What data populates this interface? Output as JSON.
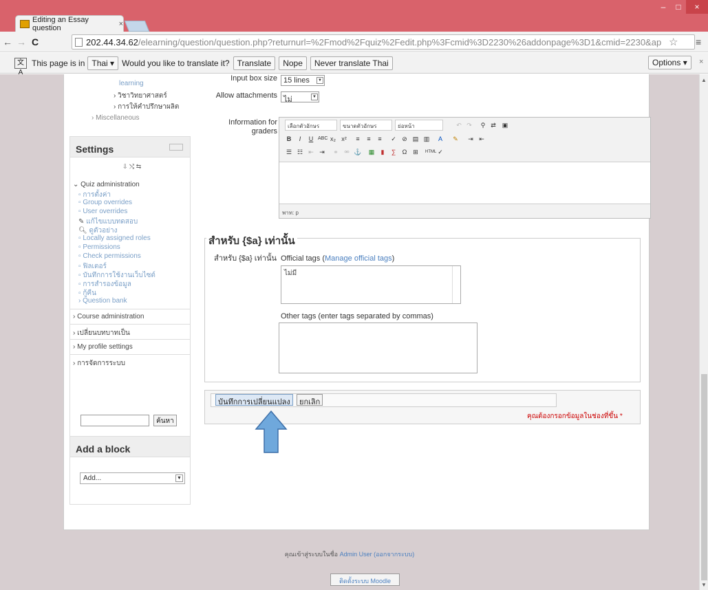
{
  "browser": {
    "tab_title": "Editing an Essay question",
    "tab_close": "×",
    "url_host": "202.44.34.62",
    "url_path": "/elearning/question/question.php?returnurl=%2Fmod%2Fquiz%2Fedit.php%3Fcmid%3D2230%26addonpage%3D1&cmid=2230&ap",
    "translate_bar": {
      "text_prefix": "This page is in",
      "language": "Thai",
      "question": "Would you like to translate it?",
      "translate_label": "Translate",
      "nope_label": "Nope",
      "never_label": "Never translate Thai",
      "options_label": "Options"
    }
  },
  "sidebar": {
    "nav_items": [
      "learning",
      "› วิชาวิทยาศาสตร์",
      "› การให้คำปรึกษาผลิต",
      "› Miscellaneous"
    ],
    "settings_title": "Settings",
    "settings_items": [
      "⌄ Quiz administration",
      "▫ การตั้งค่า",
      "▫ Group overrides",
      "▫ User overrides",
      "แก้ไขแบบทดสอบ",
      "ดูตัวอย่าง",
      "▫ Locally assigned roles",
      "▫ Permissions",
      "▫ Check permissions",
      "▫ ฟิลเตอร์",
      "▫ บันทึกการใช้งานเว็บไซต์",
      "▫ การสำรองข้อมูล",
      "▫ กู้คืน",
      "› Question bank"
    ],
    "admin_items": [
      "› Course administration",
      "› เปลี่ยนบทบาทเป็น",
      "› My profile settings",
      "› การจัดการระบบ"
    ],
    "search_button": "ค้นหา",
    "add_block_title": "Add a block",
    "add_select_value": "Add..."
  },
  "form": {
    "input_box_size_label": "Input box size",
    "input_box_size_value": "15 lines",
    "allow_attachments_label": "Allow attachments",
    "allow_attachments_value": "ไม่",
    "info_graders_label": "Information for graders",
    "editor": {
      "font_family": "เลือกตัวอักษร",
      "font_size": "ขนาดตัวอักษร",
      "paragraph": "ย่อหน้า",
      "path": "พาท: p"
    },
    "tags_legend": "สำหรับ {$a} เท่านั้น",
    "tags_row_label": "สำหรับ {$a} เท่านั้น",
    "official_tags_text": "Official tags",
    "manage_tags_link": "Manage official tags",
    "official_tags_value": "ไม่มี",
    "other_tags_label": "Other tags (enter tags separated by commas)",
    "save_button": "บันทึกการเปลี่ยนแปลง",
    "cancel_button": "ยกเลิก",
    "required_note": "คุณต้องกรอกข้อมูลในช่องที่ขึ้น",
    "required_mark": "*"
  },
  "footer": {
    "logged_in_prefix": "คุณเข้าสู่ระบบในชื่อ",
    "user_name": "Admin User",
    "logout_text": "(ออกจากระบบ)",
    "home_button": "ติดตั้งระบบ Moodle"
  },
  "colors": {
    "titlebar": "#d9626b",
    "page_bg": "#d7ced0",
    "link": "#4a7fbf",
    "required": "#c00000",
    "arrow": "#6fa8dc"
  }
}
